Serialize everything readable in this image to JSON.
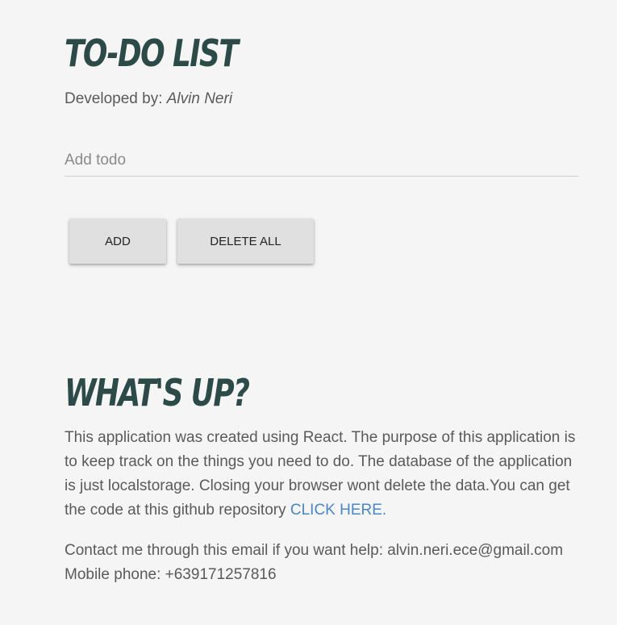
{
  "app": {
    "title": "TO-DO LIST",
    "developer_prefix": "Developed by: ",
    "developer_name": "Alvin Neri"
  },
  "todo_input": {
    "value": "",
    "placeholder": "Add todo"
  },
  "buttons": {
    "add_label": "ADD",
    "delete_all_label": "DELETE ALL"
  },
  "about": {
    "heading": "WHAT'S UP?",
    "text": "This application was created using React. The purpose of this application is to keep track on the things you need to do. The database of the application is just localstorage. Closing your browser wont delete the data.You can get the code at this github repository ",
    "link_label": "CLICK HERE."
  },
  "contact": {
    "email_line": "Contact me through this email if you want help: alvin.neri.ece@gmail.com",
    "phone_line": "Mobile phone: +639171257816"
  },
  "colors": {
    "background": "#f5f5f5",
    "heading": "#2c4a48",
    "link": "#4a86c8",
    "button": "#e0e0e0"
  }
}
